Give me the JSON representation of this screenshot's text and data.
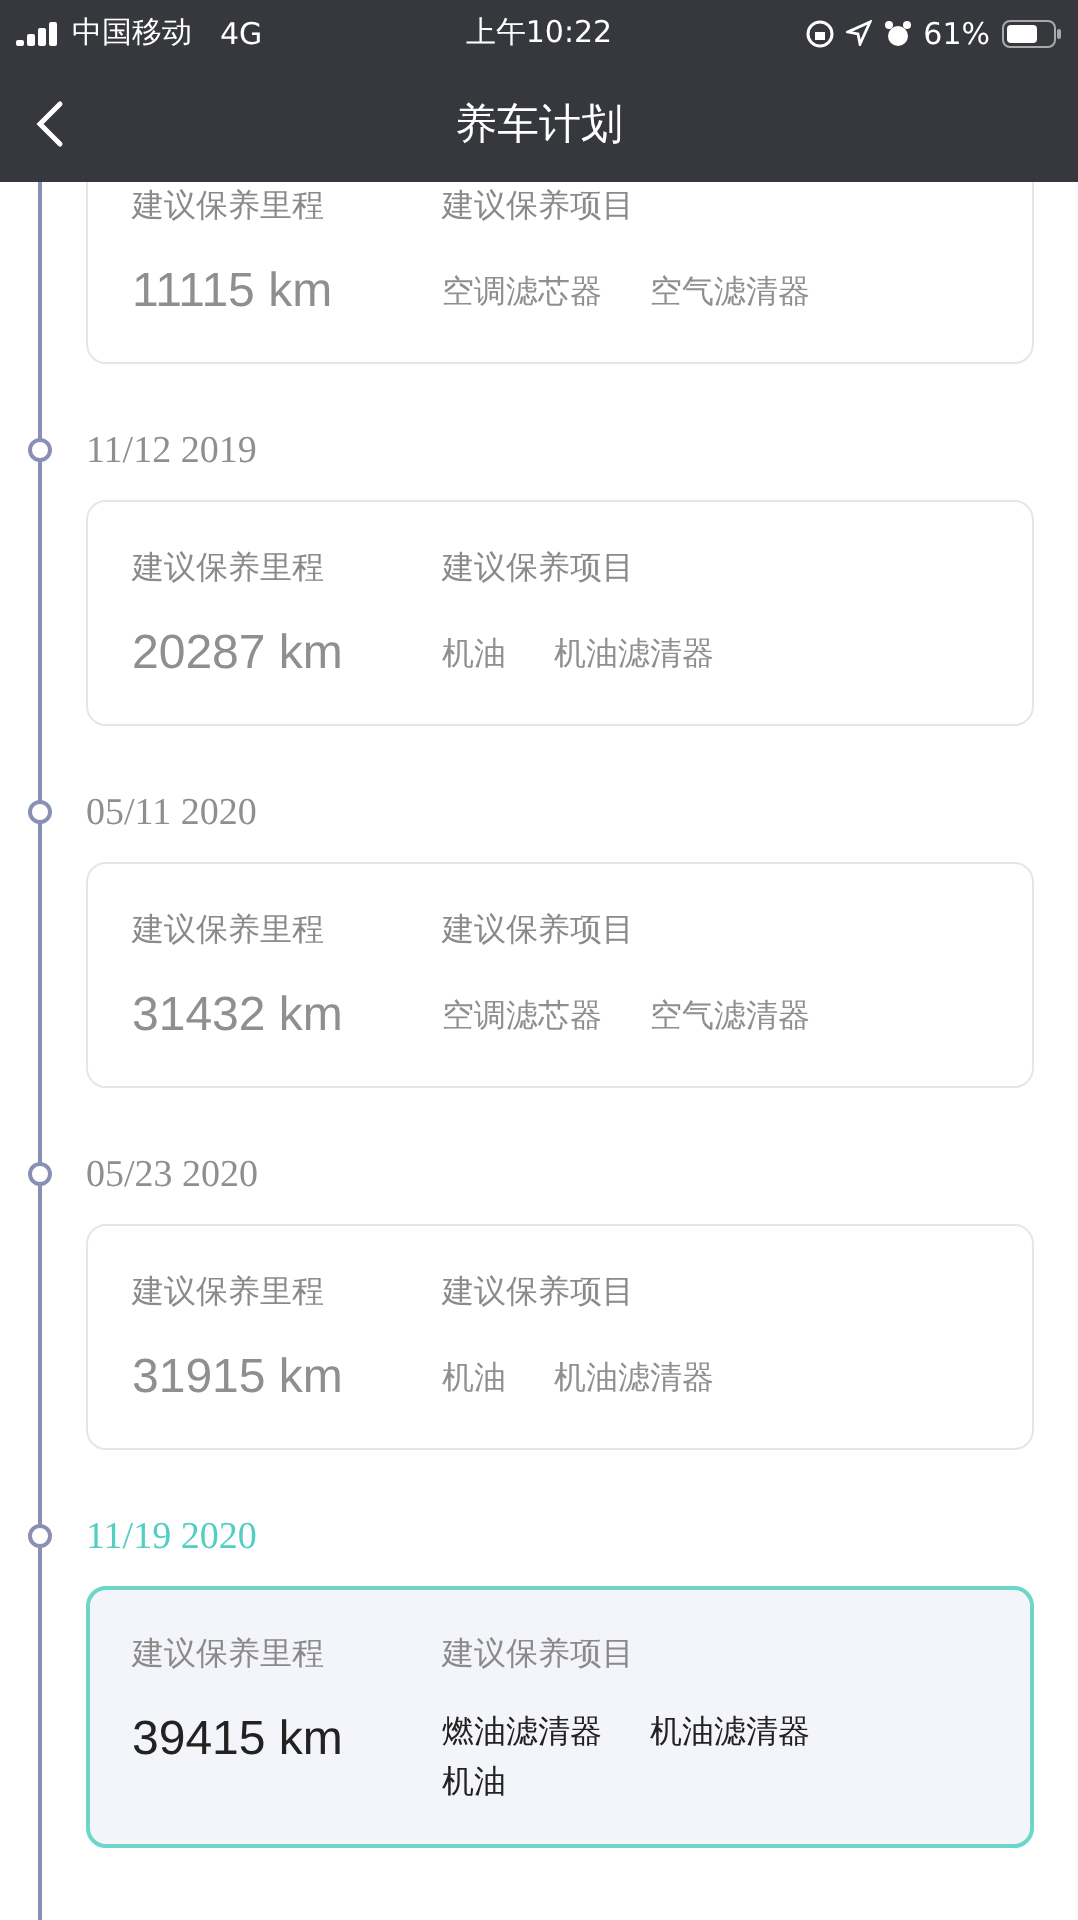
{
  "status_bar": {
    "carrier": "中国移动",
    "network": "4G",
    "time": "上午10:22",
    "battery": "61%"
  },
  "nav": {
    "title": "养车计划"
  },
  "plans": [
    {
      "selected": false,
      "mileage_label": "建议保养里程",
      "mileage": "11115 km",
      "items_label": "建议保养项目",
      "items": [
        "空调滤芯器",
        "空气滤清器"
      ]
    },
    {
      "date": "11/12 2019",
      "selected": false,
      "mileage_label": "建议保养里程",
      "mileage": "20287 km",
      "items_label": "建议保养项目",
      "items": [
        "机油",
        "机油滤清器"
      ]
    },
    {
      "date": "05/11 2020",
      "selected": false,
      "mileage_label": "建议保养里程",
      "mileage": "31432 km",
      "items_label": "建议保养项目",
      "items": [
        "空调滤芯器",
        "空气滤清器"
      ]
    },
    {
      "date": "05/23 2020",
      "selected": false,
      "mileage_label": "建议保养里程",
      "mileage": "31915 km",
      "items_label": "建议保养项目",
      "items": [
        "机油",
        "机油滤清器"
      ]
    },
    {
      "date": "11/19 2020",
      "selected": true,
      "mileage_label": "建议保养里程",
      "mileage": "39415 km",
      "items_label": "建议保养项目",
      "items": [
        "燃油滤清器",
        "机油滤清器",
        "机油"
      ]
    }
  ]
}
